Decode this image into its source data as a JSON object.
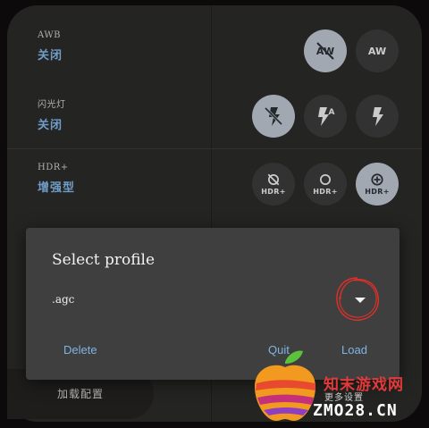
{
  "settings": [
    {
      "label": "AWB",
      "value": "关闭",
      "options": [
        {
          "icon": "awb-off-icon",
          "glyph": "AW",
          "selected": true
        },
        {
          "icon": "awb-auto-icon",
          "glyph": "AW",
          "selected": false
        }
      ]
    },
    {
      "label": "闪光灯",
      "value": "关闭",
      "options": [
        {
          "icon": "flash-off-icon",
          "selected": true
        },
        {
          "icon": "flash-auto-icon",
          "glyph": "A",
          "selected": false
        },
        {
          "icon": "flash-on-icon",
          "selected": false
        }
      ]
    },
    {
      "label": "HDR+",
      "value": "增强型",
      "options": [
        {
          "icon": "hdr-off-icon",
          "text": "HDR+",
          "selected": false
        },
        {
          "icon": "hdr-on-icon",
          "text": "HDR+",
          "selected": false
        },
        {
          "icon": "hdr-enhanced-icon",
          "text": "HDR+",
          "selected": true
        }
      ]
    }
  ],
  "dialog": {
    "title": "Select profile",
    "selected_profile": ".agc",
    "buttons": {
      "delete": "Delete",
      "quit": "Quit",
      "load": "Load"
    }
  },
  "load_config_label": "加载配置",
  "watermark": {
    "brand": "知末游戏网",
    "sub": "更多设置",
    "domain": "ZMO28.CN"
  },
  "colors": {
    "accent": "#7fb3e3",
    "selected_bg": "#b9c0cb",
    "circle_mark": "#e0302a"
  }
}
